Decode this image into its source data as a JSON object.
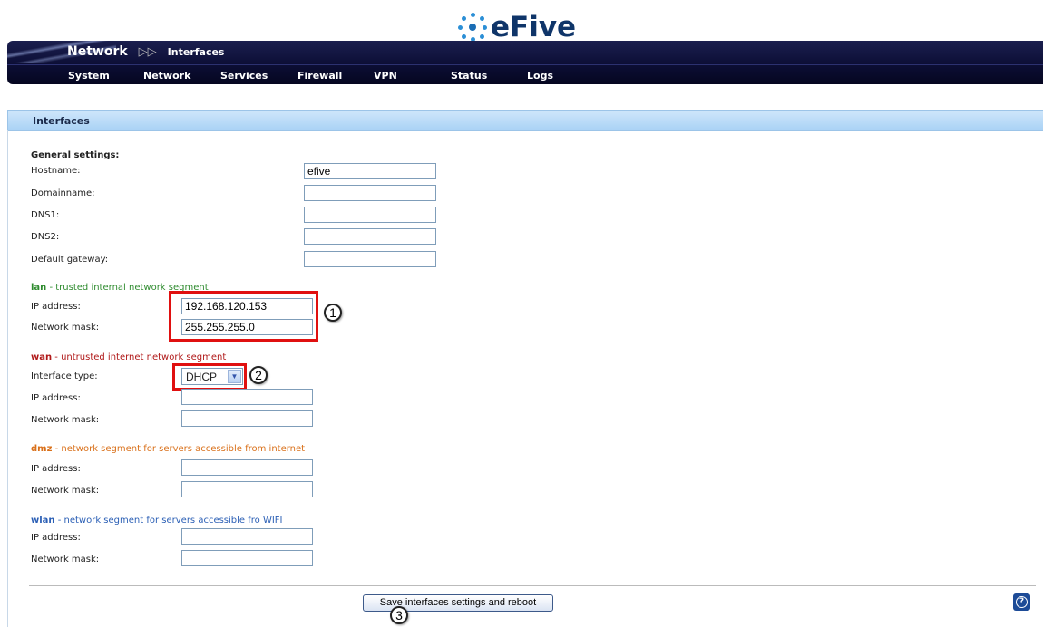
{
  "logo": {
    "text": "eFive"
  },
  "header": {
    "breadcrumb_main": "Network",
    "breadcrumb_sub": "Interfaces",
    "menu": [
      "System",
      "Network",
      "Services",
      "Firewall",
      "VPN",
      "Status",
      "Logs"
    ]
  },
  "panel": {
    "title": "Interfaces"
  },
  "general": {
    "heading": "General settings:",
    "hostname_label": "Hostname:",
    "hostname_value": "efive",
    "domainname_label": "Domainname:",
    "domainname_value": "",
    "dns1_label": "DNS1:",
    "dns1_value": "",
    "dns2_label": "DNS2:",
    "dns2_value": "",
    "gateway_label": "Default gateway:",
    "gateway_value": ""
  },
  "lan": {
    "name": "lan",
    "desc": " - trusted internal network segment",
    "ip_label": "IP address:",
    "ip_value": "192.168.120.153",
    "mask_label": "Network mask:",
    "mask_value": "255.255.255.0"
  },
  "wan": {
    "name": "wan",
    "desc": " - untrusted internet network segment",
    "type_label": "Interface type:",
    "type_value": "DHCP",
    "ip_label": "IP address:",
    "ip_value": "",
    "mask_label": "Network mask:",
    "mask_value": ""
  },
  "dmz": {
    "name": "dmz",
    "desc": " - network segment for servers accessible from internet",
    "ip_label": "IP address:",
    "ip_value": "",
    "mask_label": "Network mask:",
    "mask_value": ""
  },
  "wlan": {
    "name": "wlan",
    "desc": " - network segment for servers accessible fro WIFI",
    "ip_label": "IP address:",
    "ip_value": "",
    "mask_label": "Network mask:",
    "mask_value": ""
  },
  "actions": {
    "save_label": "Save interfaces settings and reboot"
  },
  "callouts": [
    "1",
    "2",
    "3"
  ],
  "icons": {
    "logo": "efive-logo-icon",
    "help": "help-icon",
    "breadcrumb_arrow": "double-arrow-icon"
  },
  "colors": {
    "header_bg": "#0c0e35",
    "panel_title_bg": "#a9d2f5",
    "highlight": "#e01010",
    "lan": "#2e8b2e",
    "wan": "#b01818",
    "dmz": "#d9701a",
    "wlan": "#2b5fb5"
  }
}
